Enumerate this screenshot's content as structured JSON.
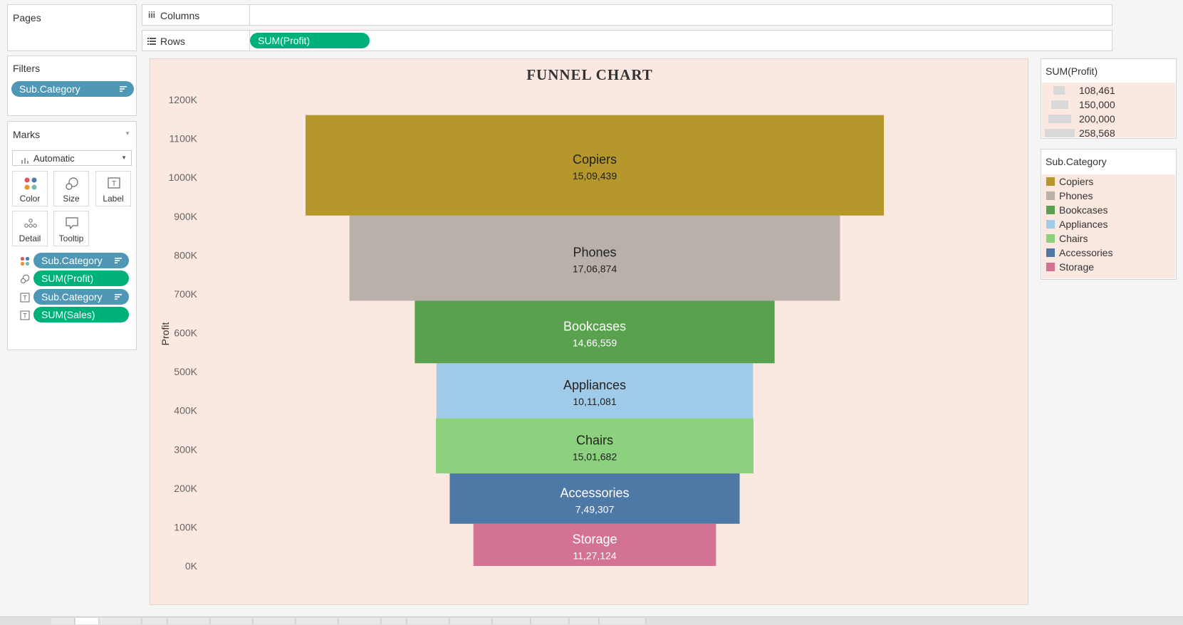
{
  "shelves": {
    "pages_label": "Pages",
    "columns_label": "Columns",
    "rows_label": "Rows",
    "rows_pill": "SUM(Profit)"
  },
  "filters": {
    "label": "Filters",
    "pill": "Sub.Category"
  },
  "marks": {
    "label": "Marks",
    "type": "Automatic",
    "buttons": {
      "color": "Color",
      "size": "Size",
      "label": "Label",
      "detail": "Detail",
      "tooltip": "Tooltip"
    },
    "fields": [
      "Sub.Category",
      "SUM(Profit)",
      "Sub.Category",
      "SUM(Sales)"
    ]
  },
  "size_legend": {
    "title": "SUM(Profit)",
    "entries": [
      "108,461",
      "150,000",
      "200,000",
      "258,568"
    ]
  },
  "color_legend": {
    "title": "Sub.Category",
    "items": [
      {
        "label": "Copiers",
        "color": "#b5972b"
      },
      {
        "label": "Phones",
        "color": "#bab0aa"
      },
      {
        "label": "Bookcases",
        "color": "#59a14f"
      },
      {
        "label": "Appliances",
        "color": "#a0cbe8"
      },
      {
        "label": "Chairs",
        "color": "#8cd17d"
      },
      {
        "label": "Accessories",
        "color": "#4e79a7"
      },
      {
        "label": "Storage",
        "color": "#d37295"
      }
    ]
  },
  "chart_data": {
    "type": "bar",
    "title": "FUNNEL CHART",
    "ylabel": "Profit",
    "ylim": [
      0,
      1200000
    ],
    "ytick_labels": [
      "0K",
      "100K",
      "200K",
      "300K",
      "400K",
      "500K",
      "600K",
      "700K",
      "800K",
      "900K",
      "1000K",
      "1100K",
      "1200K"
    ],
    "categories": [
      "Storage",
      "Accessories",
      "Chairs",
      "Appliances",
      "Bookcases",
      "Phones",
      "Copiers"
    ],
    "series": [
      {
        "profit": [
          108461,
          129626,
          141973,
          141531,
          160888,
          219327,
          258568
        ],
        "sales_labels": [
          "11,27,124",
          "7,49,307",
          "15,01,682",
          "10,11,081",
          "14,66,559",
          "17,06,874",
          "15,09,439"
        ],
        "label_colors": [
          "#ffffff",
          "#ffffff",
          "#222222",
          "#222222",
          "#ffffff",
          "#222222",
          "#222222"
        ]
      }
    ],
    "colors": [
      "#d37295",
      "#4e79a7",
      "#8cd17d",
      "#a0cbe8",
      "#59a14f",
      "#bab0aa",
      "#b5972b"
    ],
    "background": "#fbe8e0"
  }
}
